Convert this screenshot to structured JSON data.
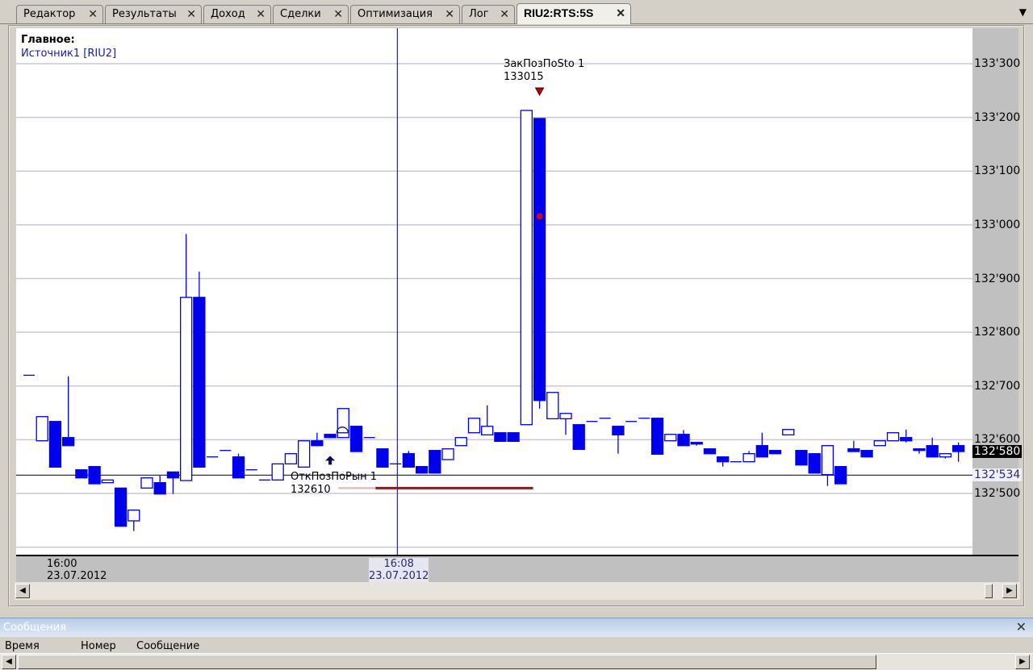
{
  "tabs": [
    {
      "label": "Редактор",
      "active": false
    },
    {
      "label": "Результаты",
      "active": false
    },
    {
      "label": "Доход",
      "active": false
    },
    {
      "label": "Сделки",
      "active": false
    },
    {
      "label": "Оптимизация",
      "active": false
    },
    {
      "label": "Лог",
      "active": false
    },
    {
      "label": "RIU2:RTS:5S",
      "active": true
    }
  ],
  "tab_close": "✕",
  "menu_icon": "▼",
  "chart": {
    "panel_title": "Главное:",
    "source": "Источник1 [RIU2]",
    "time_labels": [
      {
        "time": "16:00",
        "date": "23.07.2012"
      },
      {
        "time": "16:08",
        "date": "23.07.2012"
      }
    ],
    "current_price_label": "132'580",
    "cursor_price_label": "132'534",
    "open_signal": {
      "name": "ОткПозПоРын 1",
      "price": "132610"
    },
    "close_signal": {
      "name": "ЗакПозПоSto 1",
      "price": "133015"
    }
  },
  "messages": {
    "title": "Сообщения",
    "close": "✕",
    "columns": [
      "Время",
      "Номер",
      "Сообщение"
    ]
  },
  "colors": {
    "candle": "#0000ee",
    "cursor": "#2a2a7a",
    "stop": "#8b1a1a",
    "grid": "#c8c8d8"
  },
  "chart_data": {
    "type": "candlestick",
    "title": "RIU2:RTS:5S",
    "y_ticks": [
      "133'300",
      "133'200",
      "133'100",
      "133'000",
      "132'900",
      "132'800",
      "132'700",
      "132'600",
      "132'500"
    ],
    "y_tick_values": [
      133300,
      133200,
      133100,
      133000,
      132900,
      132800,
      132700,
      132600,
      132500
    ],
    "ylim": [
      132390,
      133370
    ],
    "ohlc": [
      [
        132720,
        132720,
        132720,
        132720
      ],
      [
        132598,
        132643,
        132598,
        132643
      ],
      [
        132634,
        132634,
        132549,
        132549
      ],
      [
        132604,
        132718,
        132589,
        132589
      ],
      [
        132544,
        132544,
        132529,
        132529
      ],
      [
        132550,
        132550,
        132518,
        132518
      ],
      [
        132520,
        132525,
        132520,
        132525
      ],
      [
        132510,
        132510,
        132439,
        132439
      ],
      [
        132449,
        132469,
        132430,
        132469
      ],
      [
        132510,
        132529,
        132510,
        132529
      ],
      [
        132520,
        132533,
        132499,
        132499
      ],
      [
        132540,
        132540,
        132499,
        132529
      ],
      [
        132524,
        132983,
        132524,
        132865
      ],
      [
        132865,
        132913,
        132549,
        132549
      ],
      [
        132568,
        132568,
        132568,
        132568
      ],
      [
        132580,
        132580,
        132580,
        132580
      ],
      [
        132568,
        132574,
        132529,
        132529
      ],
      [
        132544,
        132544,
        132544,
        132544
      ],
      [
        132525,
        132525,
        132525,
        132525
      ],
      [
        132525,
        132555,
        132525,
        132555
      ],
      [
        132555,
        132574,
        132555,
        132574
      ],
      [
        132549,
        132598,
        132549,
        132598
      ],
      [
        132598,
        132613,
        132589,
        132589
      ],
      [
        132610,
        132610,
        132604,
        132604
      ],
      [
        132604,
        132658,
        132604,
        132658
      ],
      [
        132625,
        132625,
        132578,
        132578
      ],
      [
        132604,
        132604,
        132604,
        132604
      ],
      [
        132583,
        132583,
        132549,
        132549
      ],
      [
        132555,
        132555,
        132555,
        132555
      ],
      [
        132574,
        132579,
        132549,
        132549
      ],
      [
        132550,
        132550,
        132538,
        132538
      ],
      [
        132580,
        132580,
        132538,
        132538
      ],
      [
        132563,
        132583,
        132563,
        132583
      ],
      [
        132589,
        132604,
        132589,
        132604
      ],
      [
        132613,
        132640,
        132613,
        132640
      ],
      [
        132609,
        132664,
        132609,
        132625
      ],
      [
        132613,
        132613,
        132597,
        132597
      ],
      [
        132613,
        132613,
        132597,
        132597
      ],
      [
        132628,
        133213,
        132628,
        133213
      ],
      [
        133198,
        133198,
        132658,
        132673
      ],
      [
        132639,
        132688,
        132639,
        132688
      ],
      [
        132639,
        132649,
        132609,
        132649
      ],
      [
        132628,
        132628,
        132582,
        132582
      ],
      [
        132634,
        132634,
        132634,
        132634
      ],
      [
        132640,
        132640,
        132640,
        132640
      ],
      [
        132625,
        132625,
        132574,
        132609
      ],
      [
        132634,
        132634,
        132634,
        132634
      ],
      [
        132640,
        132640,
        132640,
        132640
      ],
      [
        132640,
        132640,
        132573,
        132573
      ],
      [
        132598,
        132610,
        132598,
        132610
      ],
      [
        132610,
        132618,
        132589,
        132589
      ],
      [
        132595,
        132595,
        132589,
        132592
      ],
      [
        132583,
        132583,
        132574,
        132574
      ],
      [
        132568,
        132568,
        132550,
        132559
      ],
      [
        132559,
        132559,
        132559,
        132559
      ],
      [
        132559,
        132579,
        132559,
        132574
      ],
      [
        132589,
        132613,
        132568,
        132568
      ],
      [
        132580,
        132580,
        132574,
        132574
      ],
      [
        132609,
        132619,
        132609,
        132619
      ],
      [
        132580,
        132580,
        132553,
        132553
      ],
      [
        132574,
        132574,
        132538,
        132538
      ],
      [
        132535,
        132589,
        132514,
        132589
      ],
      [
        132550,
        132550,
        132518,
        132518
      ],
      [
        132583,
        132598,
        132578,
        132578
      ],
      [
        132580,
        132580,
        132568,
        132568
      ],
      [
        132589,
        132598,
        132589,
        132598
      ],
      [
        132598,
        132613,
        132598,
        132613
      ],
      [
        132604,
        132619,
        132595,
        132598
      ],
      [
        132583,
        132583,
        132574,
        132580
      ],
      [
        132589,
        132604,
        132568,
        132568
      ],
      [
        132568,
        132574,
        132565,
        132574
      ],
      [
        132589,
        132595,
        132559,
        132578
      ]
    ],
    "open_signal_index": 24,
    "close_signal_index": 39,
    "close_marker_price": 133016,
    "cursor_price": 132534,
    "cursor_index": 29,
    "stop_line": {
      "price": 132510,
      "from_index": 24,
      "to_index": 39
    }
  }
}
